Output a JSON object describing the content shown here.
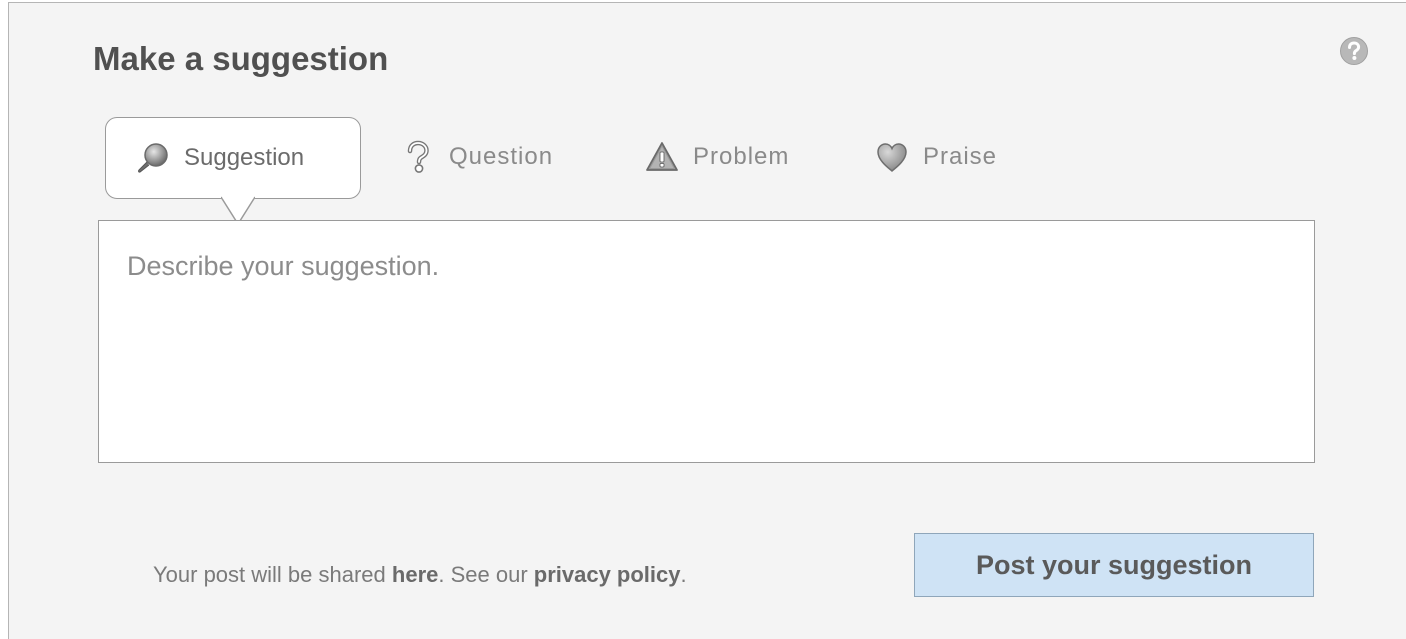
{
  "title": "Make a suggestion",
  "help": {
    "icon": "question-circle-icon"
  },
  "tabs": [
    {
      "label": "Suggestion",
      "icon": "magnifier-icon",
      "active": true
    },
    {
      "label": "Question",
      "icon": "question-mark-icon",
      "active": false
    },
    {
      "label": "Problem",
      "icon": "warning-triangle-icon",
      "active": false
    },
    {
      "label": "Praise",
      "icon": "heart-icon",
      "active": false
    }
  ],
  "textarea": {
    "placeholder": "Describe your suggestion.",
    "value": ""
  },
  "footer": {
    "prefix": "Your post will be shared ",
    "here_link": "here",
    "middle": ". See our ",
    "privacy_link": "privacy policy",
    "suffix": "."
  },
  "post_button": {
    "label": "Post your suggestion"
  },
  "colors": {
    "panel_background": "#f4f4f4",
    "button_background": "#cfe3f5",
    "text_gray": "#8a8a8a"
  }
}
